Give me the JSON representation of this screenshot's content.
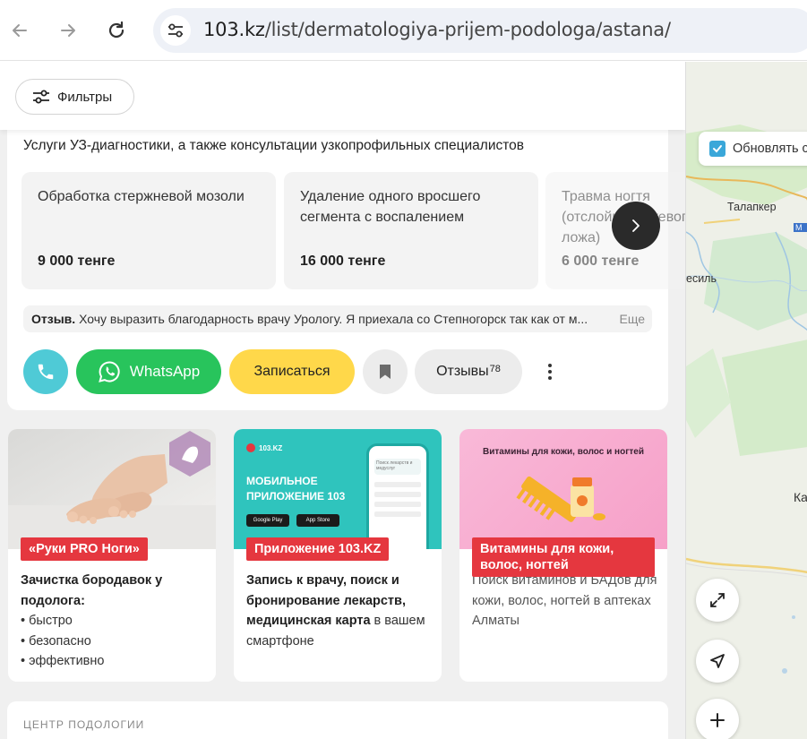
{
  "browser": {
    "url_domain": "103.kz",
    "url_path": "/list/dermatologiya-prijem-podologa/astana/"
  },
  "filters": {
    "label": "Фильтры"
  },
  "clinic": {
    "description": "Услуги УЗ-диагностики, а также консультации узкопрофильных специалистов",
    "services": [
      {
        "name": "Обработка стержневой мозоли",
        "price": "9 000 тенге"
      },
      {
        "name": "Удаление одного вросшего сегмента с воспалением",
        "price": "16 000 тенге"
      },
      {
        "name": "Травма ногтя (отслойка ногтевого ложа)",
        "price": "6 000 тенге"
      }
    ],
    "review": {
      "prefix": "Отзыв.",
      "text": "Хочу выразить благодарность врачу Урологу. Я приехала со Степногорск так как от м...",
      "more": "Еще"
    },
    "actions": {
      "whatsapp": "WhatsApp",
      "book": "Записаться",
      "reviews": "Отзывы",
      "reviews_count": "78"
    }
  },
  "promos": [
    {
      "tag": "«Руки PRO Ноги»",
      "title": "Зачистка бородавок у подолога:",
      "bullets": [
        "• быстро",
        "• безопасно",
        "• эффективно"
      ]
    },
    {
      "tag": "Приложение 103.KZ",
      "title": "Запись к врачу, поиск и бронирование лекарств, медицинская карта",
      "rest": " в вашем смартфоне",
      "img_logo": "103.KZ",
      "img_line1": "МОБИЛЬНОЕ",
      "img_line2": "ПРИЛОЖЕНИЕ 103",
      "img_store1": "Google Play",
      "img_store2": "App Store",
      "img_phone_text": "Поиск лекарств и медуслуг"
    },
    {
      "tag": "Витамины для кожи, волос, ногтей",
      "title": "Поиск витаминов и БАДов для кожи, волос, ногтей в аптеках Алматы",
      "img_title": "Витамины для кожи, волос и ногтей"
    }
  ],
  "next_section": {
    "label": "ЦЕНТР ПОДОЛОГИИ"
  },
  "map": {
    "refresh_label": "Обновлять с",
    "cities": [
      "Талапкер",
      "есиль",
      "Ка"
    ],
    "road_marker": "М"
  },
  "colors": {
    "whatsapp": "#28c45c",
    "book": "#ffd84a",
    "call": "#4fcad6",
    "tag": "#e5373f"
  }
}
